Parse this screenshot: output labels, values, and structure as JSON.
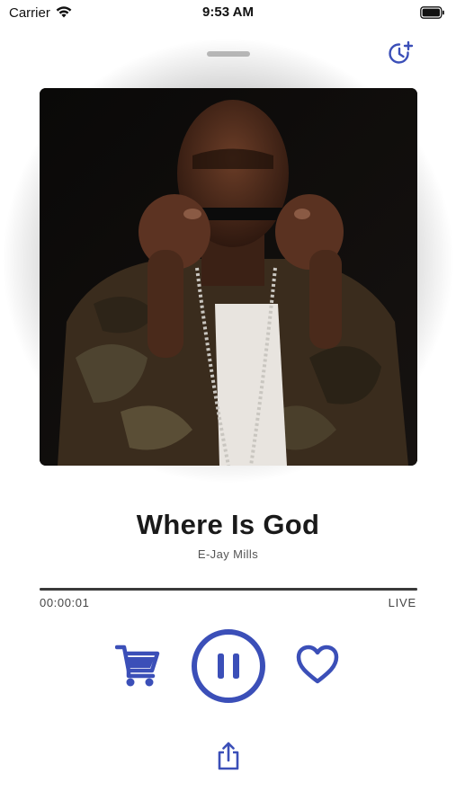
{
  "status_bar": {
    "carrier": "Carrier",
    "time": "9:53 AM",
    "wifi_icon": "wifi-icon",
    "battery_icon": "battery-icon"
  },
  "header": {
    "grabber": "sheet-grabber",
    "timer_icon": "sleep-timer-icon"
  },
  "now_playing": {
    "artwork": "album-artwork",
    "title": "Where Is God",
    "artist": "E-Jay Mills"
  },
  "progress": {
    "elapsed": "00:00:01",
    "status": "LIVE",
    "fraction": 1.0
  },
  "controls": {
    "cart_icon": "shopping-cart-icon",
    "pause_icon": "pause-icon",
    "heart_icon": "heart-icon",
    "share_icon": "share-icon"
  },
  "colors": {
    "accent": "#3b4fb8",
    "text_primary": "#1a1a1a",
    "text_secondary": "#555555"
  }
}
